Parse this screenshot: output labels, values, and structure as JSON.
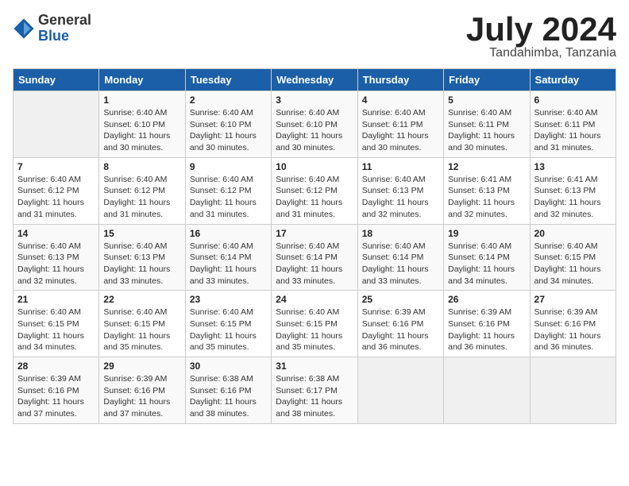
{
  "header": {
    "logo_general": "General",
    "logo_blue": "Blue",
    "title": "July 2024",
    "location": "Tandahimba, Tanzania"
  },
  "calendar": {
    "days_of_week": [
      "Sunday",
      "Monday",
      "Tuesday",
      "Wednesday",
      "Thursday",
      "Friday",
      "Saturday"
    ],
    "weeks": [
      [
        {
          "day": "",
          "detail": ""
        },
        {
          "day": "1",
          "detail": "Sunrise: 6:40 AM\nSunset: 6:10 PM\nDaylight: 11 hours\nand 30 minutes."
        },
        {
          "day": "2",
          "detail": "Sunrise: 6:40 AM\nSunset: 6:10 PM\nDaylight: 11 hours\nand 30 minutes."
        },
        {
          "day": "3",
          "detail": "Sunrise: 6:40 AM\nSunset: 6:10 PM\nDaylight: 11 hours\nand 30 minutes."
        },
        {
          "day": "4",
          "detail": "Sunrise: 6:40 AM\nSunset: 6:11 PM\nDaylight: 11 hours\nand 30 minutes."
        },
        {
          "day": "5",
          "detail": "Sunrise: 6:40 AM\nSunset: 6:11 PM\nDaylight: 11 hours\nand 30 minutes."
        },
        {
          "day": "6",
          "detail": "Sunrise: 6:40 AM\nSunset: 6:11 PM\nDaylight: 11 hours\nand 31 minutes."
        }
      ],
      [
        {
          "day": "7",
          "detail": "Sunrise: 6:40 AM\nSunset: 6:12 PM\nDaylight: 11 hours\nand 31 minutes."
        },
        {
          "day": "8",
          "detail": "Sunrise: 6:40 AM\nSunset: 6:12 PM\nDaylight: 11 hours\nand 31 minutes."
        },
        {
          "day": "9",
          "detail": "Sunrise: 6:40 AM\nSunset: 6:12 PM\nDaylight: 11 hours\nand 31 minutes."
        },
        {
          "day": "10",
          "detail": "Sunrise: 6:40 AM\nSunset: 6:12 PM\nDaylight: 11 hours\nand 31 minutes."
        },
        {
          "day": "11",
          "detail": "Sunrise: 6:40 AM\nSunset: 6:13 PM\nDaylight: 11 hours\nand 32 minutes."
        },
        {
          "day": "12",
          "detail": "Sunrise: 6:41 AM\nSunset: 6:13 PM\nDaylight: 11 hours\nand 32 minutes."
        },
        {
          "day": "13",
          "detail": "Sunrise: 6:41 AM\nSunset: 6:13 PM\nDaylight: 11 hours\nand 32 minutes."
        }
      ],
      [
        {
          "day": "14",
          "detail": "Sunrise: 6:40 AM\nSunset: 6:13 PM\nDaylight: 11 hours\nand 32 minutes."
        },
        {
          "day": "15",
          "detail": "Sunrise: 6:40 AM\nSunset: 6:13 PM\nDaylight: 11 hours\nand 33 minutes."
        },
        {
          "day": "16",
          "detail": "Sunrise: 6:40 AM\nSunset: 6:14 PM\nDaylight: 11 hours\nand 33 minutes."
        },
        {
          "day": "17",
          "detail": "Sunrise: 6:40 AM\nSunset: 6:14 PM\nDaylight: 11 hours\nand 33 minutes."
        },
        {
          "day": "18",
          "detail": "Sunrise: 6:40 AM\nSunset: 6:14 PM\nDaylight: 11 hours\nand 33 minutes."
        },
        {
          "day": "19",
          "detail": "Sunrise: 6:40 AM\nSunset: 6:14 PM\nDaylight: 11 hours\nand 34 minutes."
        },
        {
          "day": "20",
          "detail": "Sunrise: 6:40 AM\nSunset: 6:15 PM\nDaylight: 11 hours\nand 34 minutes."
        }
      ],
      [
        {
          "day": "21",
          "detail": "Sunrise: 6:40 AM\nSunset: 6:15 PM\nDaylight: 11 hours\nand 34 minutes."
        },
        {
          "day": "22",
          "detail": "Sunrise: 6:40 AM\nSunset: 6:15 PM\nDaylight: 11 hours\nand 35 minutes."
        },
        {
          "day": "23",
          "detail": "Sunrise: 6:40 AM\nSunset: 6:15 PM\nDaylight: 11 hours\nand 35 minutes."
        },
        {
          "day": "24",
          "detail": "Sunrise: 6:40 AM\nSunset: 6:15 PM\nDaylight: 11 hours\nand 35 minutes."
        },
        {
          "day": "25",
          "detail": "Sunrise: 6:39 AM\nSunset: 6:16 PM\nDaylight: 11 hours\nand 36 minutes."
        },
        {
          "day": "26",
          "detail": "Sunrise: 6:39 AM\nSunset: 6:16 PM\nDaylight: 11 hours\nand 36 minutes."
        },
        {
          "day": "27",
          "detail": "Sunrise: 6:39 AM\nSunset: 6:16 PM\nDaylight: 11 hours\nand 36 minutes."
        }
      ],
      [
        {
          "day": "28",
          "detail": "Sunrise: 6:39 AM\nSunset: 6:16 PM\nDaylight: 11 hours\nand 37 minutes."
        },
        {
          "day": "29",
          "detail": "Sunrise: 6:39 AM\nSunset: 6:16 PM\nDaylight: 11 hours\nand 37 minutes."
        },
        {
          "day": "30",
          "detail": "Sunrise: 6:38 AM\nSunset: 6:16 PM\nDaylight: 11 hours\nand 38 minutes."
        },
        {
          "day": "31",
          "detail": "Sunrise: 6:38 AM\nSunset: 6:17 PM\nDaylight: 11 hours\nand 38 minutes."
        },
        {
          "day": "",
          "detail": ""
        },
        {
          "day": "",
          "detail": ""
        },
        {
          "day": "",
          "detail": ""
        }
      ]
    ]
  }
}
